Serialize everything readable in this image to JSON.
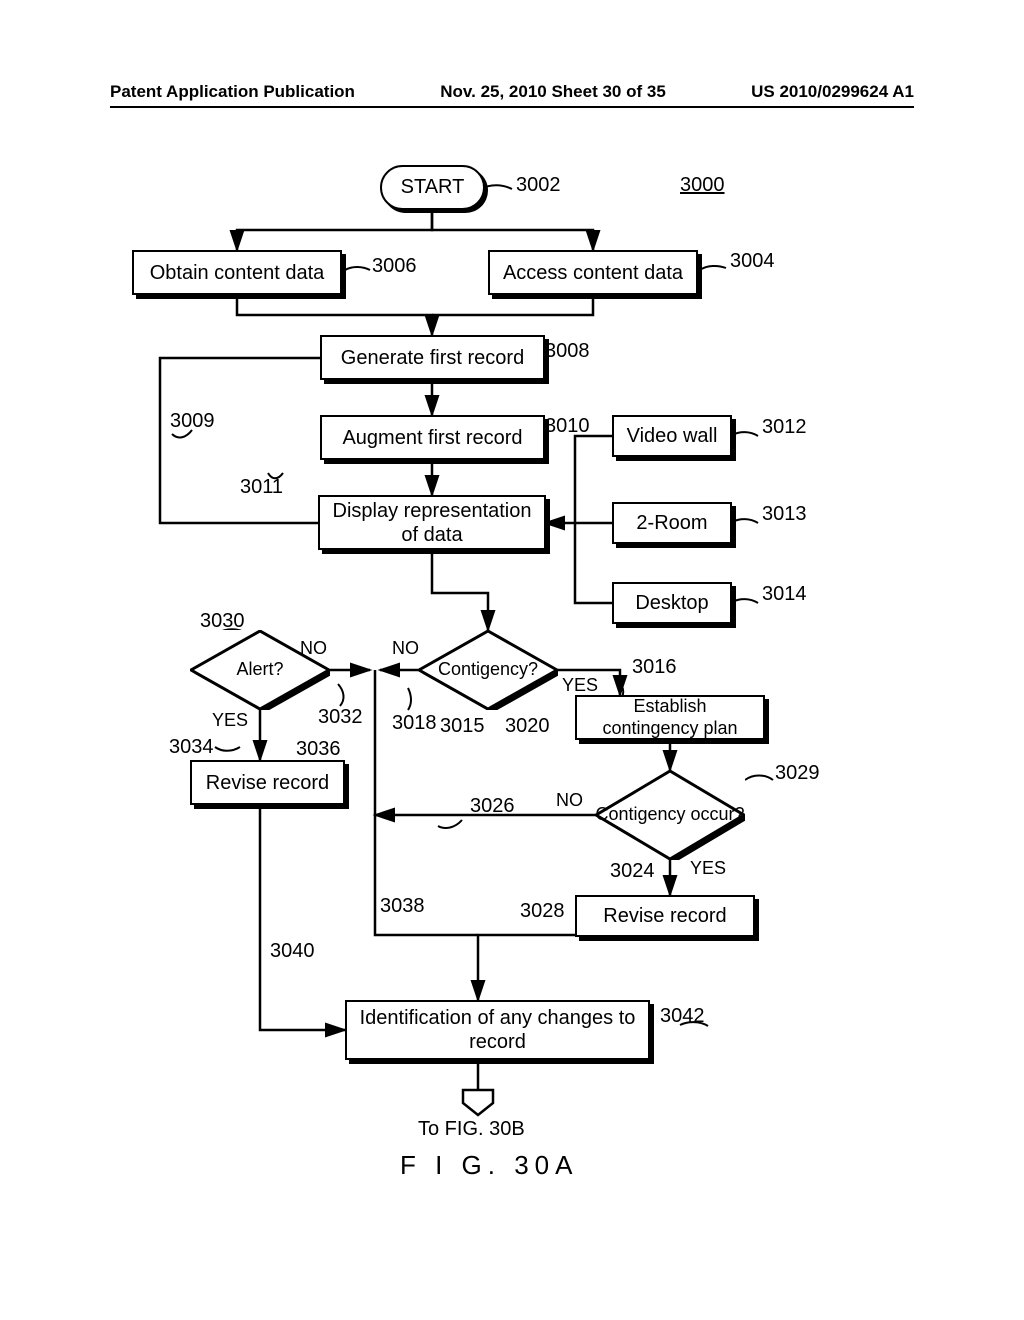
{
  "header": {
    "left": "Patent Application Publication",
    "center": "Nov. 25, 2010  Sheet 30 of 35",
    "right": "US 2010/0299624 A1"
  },
  "nodes": {
    "start": "START",
    "obtain": "Obtain content data",
    "access": "Access content data",
    "gen": "Generate first record",
    "aug": "Augment first record",
    "disp": "Display representation of data",
    "vw": "Video wall",
    "room": "2-Room",
    "desk": "Desktop",
    "alert": "Alert?",
    "cont": "Contigency?",
    "estab": "Establish contingency plan",
    "occur": "Contigency occur?",
    "rev1": "Revise record",
    "rev2": "Revise record",
    "ident": "Identification of any changes to record"
  },
  "labels": {
    "yes": "YES",
    "no": "NO"
  },
  "refs": {
    "r3000": "3000",
    "r3002": "3002",
    "r3004": "3004",
    "r3006": "3006",
    "r3008": "3008",
    "r3009": "3009",
    "r3010": "3010",
    "r3011": "3011",
    "r3012": "3012",
    "r3013": "3013",
    "r3014": "3014",
    "r3015": "3015",
    "r3016": "3016",
    "r3018": "3018",
    "r3020": "3020",
    "r3024": "3024",
    "r3026": "3026",
    "r3028": "3028",
    "r3029": "3029",
    "r3030": "3030",
    "r3032": "3032",
    "r3034": "3034",
    "r3036": "3036",
    "r3038": "3038",
    "r3040": "3040",
    "r3042": "3042"
  },
  "caption": {
    "to": "To FIG. 30B",
    "fig": "F I G. 30A"
  }
}
